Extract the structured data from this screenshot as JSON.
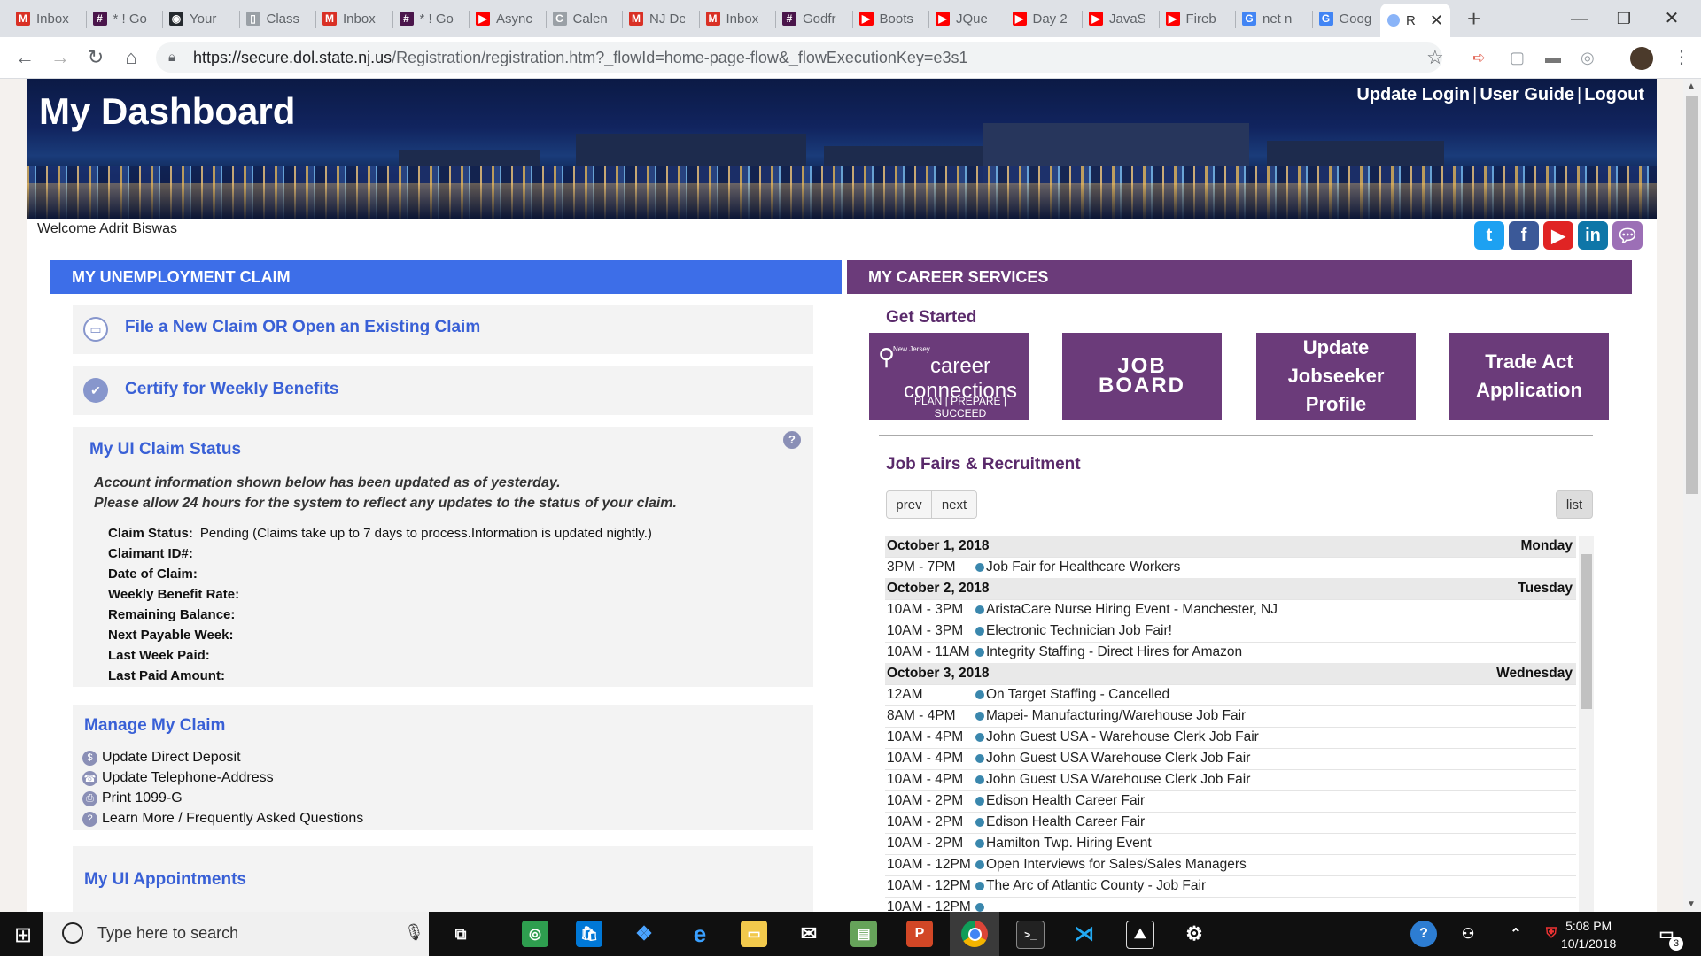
{
  "browser": {
    "tabs": [
      {
        "label": "Inbox",
        "icon": "gmail-icon",
        "color": "#d93025",
        "glyph": "M"
      },
      {
        "label": "* ! Go",
        "icon": "slack-icon",
        "color": "#4a154b",
        "glyph": "#"
      },
      {
        "label": "Your",
        "icon": "github-icon",
        "color": "#24292e",
        "glyph": "◉"
      },
      {
        "label": "Class",
        "icon": "document-icon",
        "color": "#9aa0a6",
        "glyph": "▯"
      },
      {
        "label": "Inbox",
        "icon": "gmail-icon",
        "color": "#d93025",
        "glyph": "M"
      },
      {
        "label": "* ! Go",
        "icon": "slack-icon",
        "color": "#4a154b",
        "glyph": "#"
      },
      {
        "label": "Async",
        "icon": "youtube-icon",
        "color": "#ff0000",
        "glyph": "▶"
      },
      {
        "label": "Calen",
        "icon": "calendar-icon",
        "color": "#9aa0a6",
        "glyph": "C"
      },
      {
        "label": "NJ De",
        "icon": "gmail-icon",
        "color": "#d93025",
        "glyph": "M"
      },
      {
        "label": "Inbox",
        "icon": "gmail-icon",
        "color": "#d93025",
        "glyph": "M"
      },
      {
        "label": "Godfr",
        "icon": "slack-icon",
        "color": "#4a154b",
        "glyph": "#"
      },
      {
        "label": "Boots",
        "icon": "youtube-icon",
        "color": "#ff0000",
        "glyph": "▶"
      },
      {
        "label": "JQue",
        "icon": "youtube-icon",
        "color": "#ff0000",
        "glyph": "▶"
      },
      {
        "label": "Day 2",
        "icon": "youtube-icon",
        "color": "#ff0000",
        "glyph": "▶"
      },
      {
        "label": "JavaS",
        "icon": "youtube-icon",
        "color": "#ff0000",
        "glyph": "▶"
      },
      {
        "label": "Fireb",
        "icon": "youtube-icon",
        "color": "#ff0000",
        "glyph": "▶"
      },
      {
        "label": "net n",
        "icon": "google-icon",
        "color": "#4285f4",
        "glyph": "G"
      },
      {
        "label": "Goog",
        "icon": "google-icon",
        "color": "#4285f4",
        "glyph": "G"
      }
    ],
    "active_tab": {
      "label": "R",
      "icon": "nj-icon"
    },
    "url_host": "https://secure.dol.state.nj.us",
    "url_path": "/Registration/registration.htm?_flowId=home-page-flow&_flowExecutionKey=e3s1"
  },
  "header": {
    "title": "My Dashboard",
    "links": [
      "Update Login",
      "User Guide",
      "Logout"
    ],
    "welcome_prefix": "Welcome",
    "welcome_name": "Adrit Biswas"
  },
  "unemployment": {
    "heading": "MY UNEMPLOYMENT CLAIM",
    "file_claim": "File a New Claim OR Open an Existing Claim",
    "certify": "Certify for Weekly Benefits",
    "status_title": "My UI Claim Status",
    "note_line1": "Account information shown below has been updated as of yesterday.",
    "note_line2": "Please allow 24 hours for the system to reflect any updates to the status of your claim.",
    "fields": [
      {
        "label": "Claim Status:",
        "value": "Pending (Claims take up to 7 days to process.Information is updated nightly.)"
      },
      {
        "label": "Claimant ID#:",
        "value": ""
      },
      {
        "label": "Date of Claim:",
        "value": ""
      },
      {
        "label": "Weekly Benefit Rate:",
        "value": ""
      },
      {
        "label": "Remaining Balance:",
        "value": ""
      },
      {
        "label": "Next Payable Week:",
        "value": ""
      },
      {
        "label": "Last Week Paid:",
        "value": ""
      },
      {
        "label": "Last Paid Amount:",
        "value": ""
      }
    ],
    "manage_title": "Manage My Claim",
    "manage_items": [
      {
        "label": "Update Direct Deposit",
        "icon": "dollar-icon"
      },
      {
        "label": "Update Telephone-Address",
        "icon": "phone-icon"
      },
      {
        "label": "Print 1099-G",
        "icon": "printer-icon"
      },
      {
        "label": "Learn More / Frequently Asked Questions",
        "icon": "question-icon"
      }
    ],
    "appointments_title": "My UI Appointments"
  },
  "career": {
    "heading": "MY CAREER SERVICES",
    "get_started": "Get Started",
    "tiles": {
      "cc_small": "New Jersey",
      "cc_name": "career connections",
      "cc_tagline": "PLAN | PREPARE | SUCCEED",
      "job_board_1": "JOB",
      "job_board_2": "BOARD",
      "update_profile_1": "Update Jobseeker",
      "update_profile_2": "Profile",
      "trade_act_1": "Trade Act",
      "trade_act_2": "Application"
    },
    "job_fairs_title": "Job Fairs & Recruitment",
    "prev": "prev",
    "next": "next",
    "list": "list",
    "calendar": [
      {
        "type": "day",
        "date": "October 1, 2018",
        "dow": "Monday"
      },
      {
        "type": "event",
        "time": "3PM - 7PM",
        "title": "Job Fair for Healthcare Workers"
      },
      {
        "type": "day",
        "date": "October 2, 2018",
        "dow": "Tuesday"
      },
      {
        "type": "event",
        "time": "10AM - 3PM",
        "title": "AristaCare Nurse Hiring Event - Manchester, NJ"
      },
      {
        "type": "event",
        "time": "10AM - 3PM",
        "title": "Electronic Technician Job Fair!"
      },
      {
        "type": "event",
        "time": "10AM - 11AM",
        "title": "Integrity Staffing - Direct Hires for Amazon"
      },
      {
        "type": "day",
        "date": "October 3, 2018",
        "dow": "Wednesday"
      },
      {
        "type": "event",
        "time": "12AM",
        "title": "On Target Staffing - Cancelled"
      },
      {
        "type": "event",
        "time": "8AM - 4PM",
        "title": "Mapei- Manufacturing/Warehouse Job Fair"
      },
      {
        "type": "event",
        "time": "10AM - 4PM",
        "title": "John Guest USA - Warehouse Clerk Job Fair"
      },
      {
        "type": "event",
        "time": "10AM - 4PM",
        "title": "John Guest USA Warehouse Clerk Job Fair"
      },
      {
        "type": "event",
        "time": "10AM - 4PM",
        "title": "John Guest USA Warehouse Clerk Job Fair"
      },
      {
        "type": "event",
        "time": "10AM - 2PM",
        "title": "Edison Health Career Fair"
      },
      {
        "type": "event",
        "time": "10AM - 2PM",
        "title": "Edison Health Career Fair"
      },
      {
        "type": "event",
        "time": "10AM - 2PM",
        "title": "Hamilton Twp. Hiring Event"
      },
      {
        "type": "event",
        "time": "10AM - 12PM",
        "title": "Open Interviews for Sales/Sales Managers"
      },
      {
        "type": "event",
        "time": "10AM - 12PM",
        "title": "The Arc of Atlantic County - Job Fair"
      },
      {
        "type": "event",
        "time": "10AM - 12PM",
        "title": ""
      }
    ]
  },
  "taskbar": {
    "search_placeholder": "Type here to search",
    "time": "5:08 PM",
    "date": "10/1/2018",
    "notification_count": "3"
  }
}
